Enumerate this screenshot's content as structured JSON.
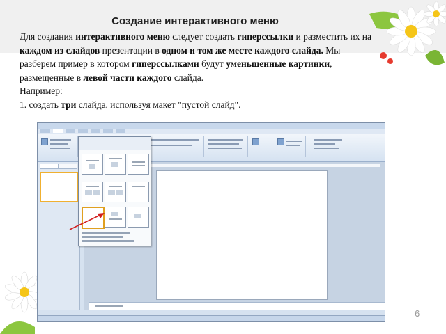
{
  "title": "Создание интерактивного меню",
  "paragraph": {
    "t1": "Для создания ",
    "b1": "интерактивного меню",
    "t2": " следует создать ",
    "b2": "гиперссылки",
    "t3": " и разместить их на ",
    "b3": "каждом из слайдов",
    "t4": " презентации в ",
    "b4": "одном и том же месте каждого слайда.",
    "t5": " Мы разберем пример в котором ",
    "b5": "гиперссылками",
    "t6": " будут ",
    "b6": "уменьшенные картинки",
    "t7": ", размещенные в ",
    "b7": "левой части каждого",
    "t8": " слайда."
  },
  "example_label": "Например:",
  "step": {
    "t1": "1. создать ",
    "b1": "три",
    "t2": " слайда, используя макет \"пустой слайд\"."
  },
  "page_number": "6",
  "colors": {
    "header_band": "#f0f0f0",
    "ribbon": "#d5e2f1",
    "arrow": "#d21e1e",
    "selection": "#e0a020"
  },
  "icons": {
    "top_right": "daisy-bouquet-icon",
    "bottom_left": "daisy-flowers-icon",
    "pointer": "red-arrow-icon"
  }
}
